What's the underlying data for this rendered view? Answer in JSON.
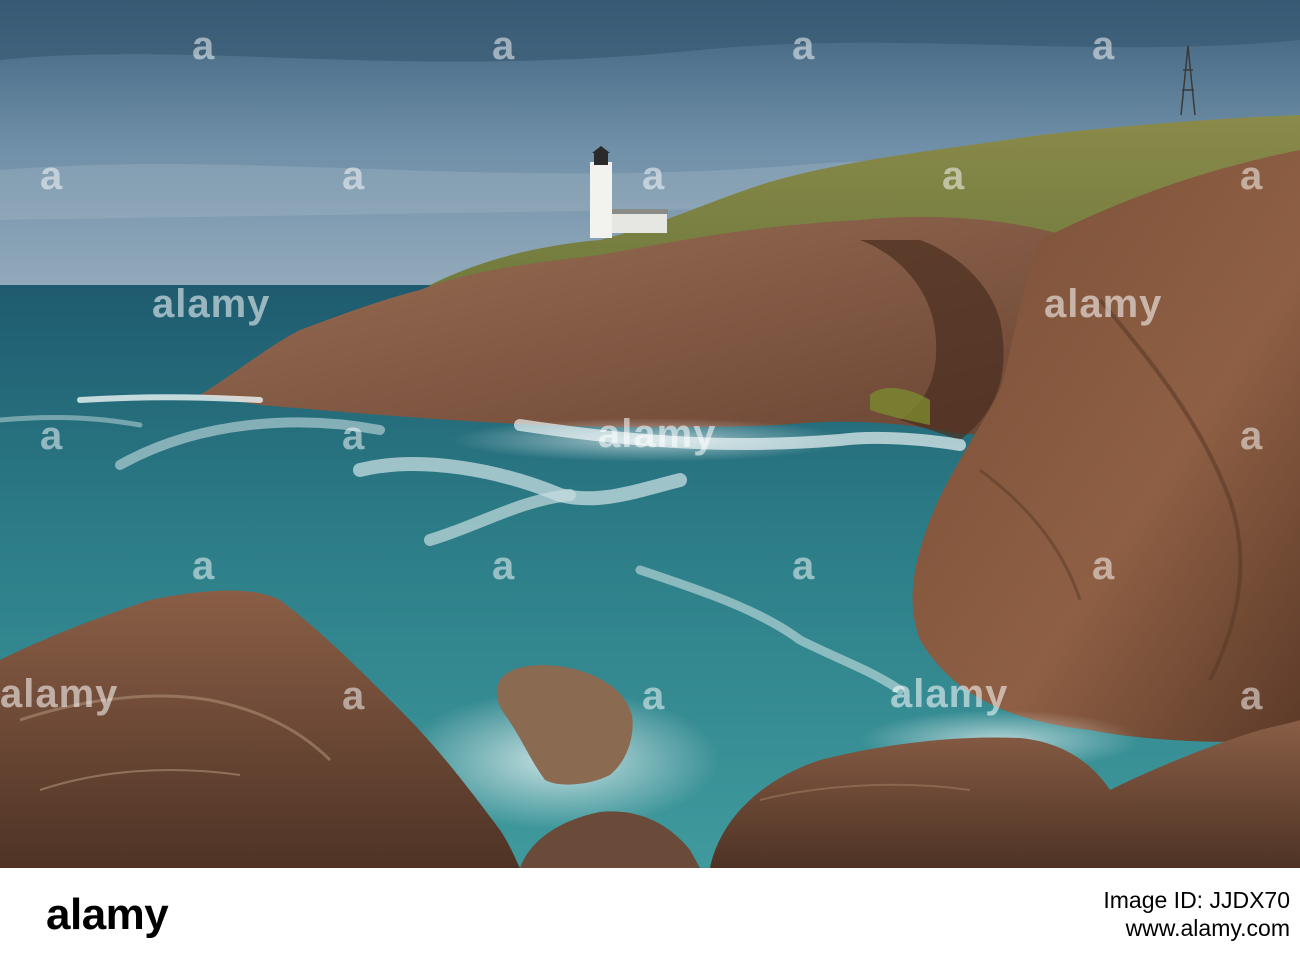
{
  "photo": {
    "subject": "lighthouse-on-rocky-coastal-headland"
  },
  "watermark": {
    "text": "alamy",
    "corner_mark": "a"
  },
  "footer": {
    "brand": "alamy",
    "image_id": "Image ID: JJDX70",
    "site_url": "www.alamy.com"
  }
}
